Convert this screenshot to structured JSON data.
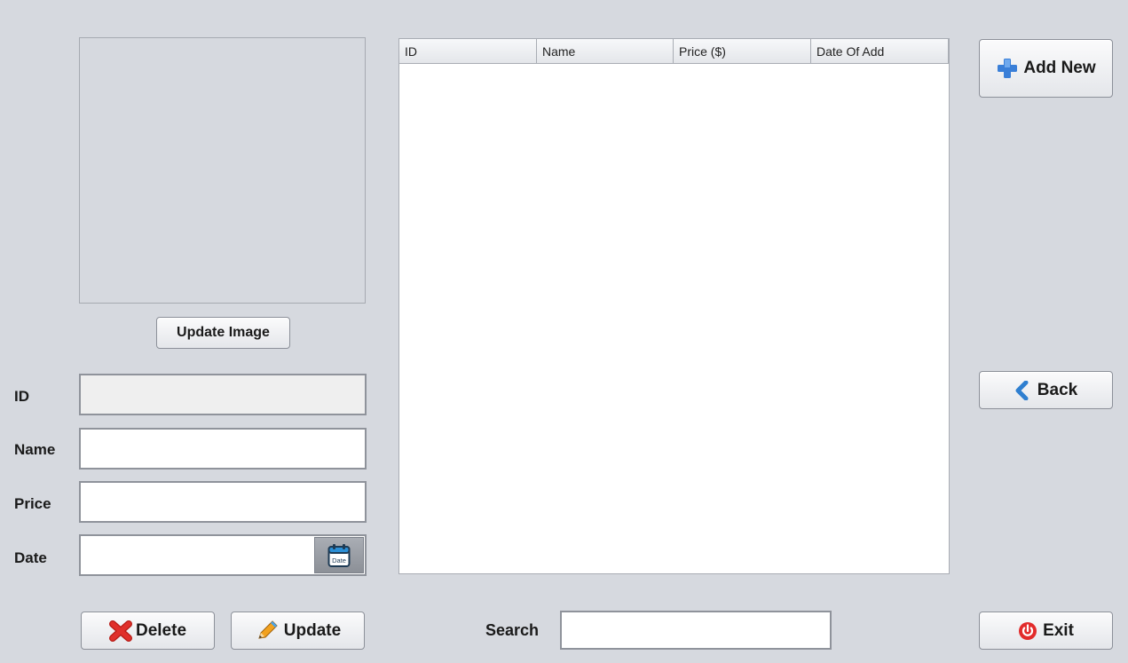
{
  "image_panel": {
    "update_image_label": "Update Image"
  },
  "form": {
    "id_label": "ID",
    "id_value": "",
    "name_label": "Name",
    "name_value": "",
    "price_label": "Price",
    "price_value": "",
    "date_label": "Date",
    "date_value": "",
    "date_button_icon": "calendar-icon",
    "date_icon_text": "Date"
  },
  "table": {
    "columns": [
      "ID",
      "Name",
      "Price ($)",
      "Date Of Add"
    ],
    "rows": []
  },
  "actions": {
    "add_new_label": "Add New",
    "add_new_icon": "plus-icon",
    "back_label": "Back",
    "back_icon": "chevron-left-icon",
    "delete_label": "Delete",
    "delete_icon": "red-x-icon",
    "update_label": "Update",
    "update_icon": "pencil-icon",
    "exit_label": "Exit",
    "exit_icon": "power-icon"
  },
  "search": {
    "label": "Search",
    "value": ""
  },
  "colors": {
    "background": "#d6d9df",
    "plus_blue": "#3a7fd8",
    "back_blue": "#2f7fd0",
    "delete_red": "#e0302b",
    "exit_red": "#e22b2b"
  }
}
